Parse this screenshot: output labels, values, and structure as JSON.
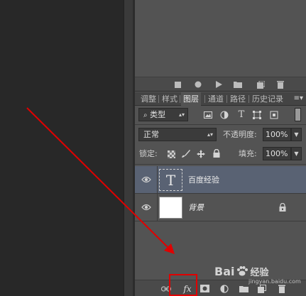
{
  "tabs": [
    {
      "label": "调整",
      "active": false
    },
    {
      "label": "样式",
      "active": false
    },
    {
      "label": "图层",
      "active": true
    },
    {
      "label": "通道",
      "active": false
    },
    {
      "label": "路径",
      "active": false
    },
    {
      "label": "历史记录",
      "active": false
    }
  ],
  "filter": {
    "kind_label": "类型"
  },
  "blend": {
    "mode": "正常",
    "opacity_label": "不透明度:",
    "opacity_value": "100%"
  },
  "lock": {
    "label": "锁定:",
    "fill_label": "填充:",
    "fill_value": "100%"
  },
  "layers": [
    {
      "name": "百度经验",
      "thumb": "T",
      "selected": true
    },
    {
      "name": "背景",
      "thumb": "",
      "selected": false,
      "locked": true
    }
  ],
  "footer": {
    "fx_label": "fx"
  },
  "watermark": {
    "brand": "Bai",
    "sub": "经验",
    "url": "jingyan.baidu.com"
  },
  "colors": {
    "panel": "#535353",
    "selected_layer": "#596273",
    "highlight": "#e00000"
  }
}
